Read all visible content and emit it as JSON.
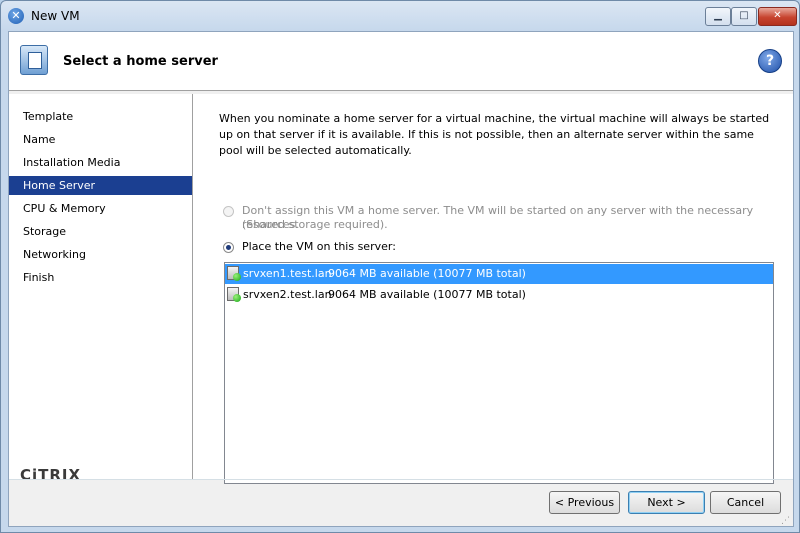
{
  "window": {
    "title": "New VM"
  },
  "caption_buttons": {
    "minimize": "▁",
    "maximize": "□",
    "close": "✕"
  },
  "header": {
    "title": "Select a home server",
    "help": "?"
  },
  "sidebar": {
    "items": [
      {
        "label": "Template"
      },
      {
        "label": "Name"
      },
      {
        "label": "Installation Media"
      },
      {
        "label": "Home Server",
        "active": true
      },
      {
        "label": "CPU & Memory"
      },
      {
        "label": "Storage"
      },
      {
        "label": "Networking"
      },
      {
        "label": "Finish"
      }
    ],
    "logo": "CiTRIX"
  },
  "main": {
    "description": "When you nominate a home server for a virtual machine, the virtual machine will always be started up on that server if it is available. If this is not possible, then an alternate server within the same pool will be selected automatically.",
    "option_no_home": {
      "label": "Don't assign this VM a home server. The VM will be started on any server with the necessary resources.",
      "note": "(Shared storage required).",
      "checked": false,
      "enabled": false
    },
    "option_place": {
      "label": "Place the VM on this server:",
      "checked": true,
      "enabled": true
    },
    "servers": [
      {
        "name": "srvxen1.test.lan",
        "info": "9064 MB available (10077 MB total)",
        "selected": true,
        "icon": "server-online-icon"
      },
      {
        "name": "srvxen2.test.lan",
        "info": "9064 MB available (10077 MB total)",
        "selected": false,
        "icon": "server-online-icon"
      }
    ]
  },
  "footer": {
    "previous": "< Previous",
    "next": "Next >",
    "cancel": "Cancel"
  },
  "colors": {
    "selection_nav": "#1b3f91",
    "selection_list": "#3399ff"
  }
}
